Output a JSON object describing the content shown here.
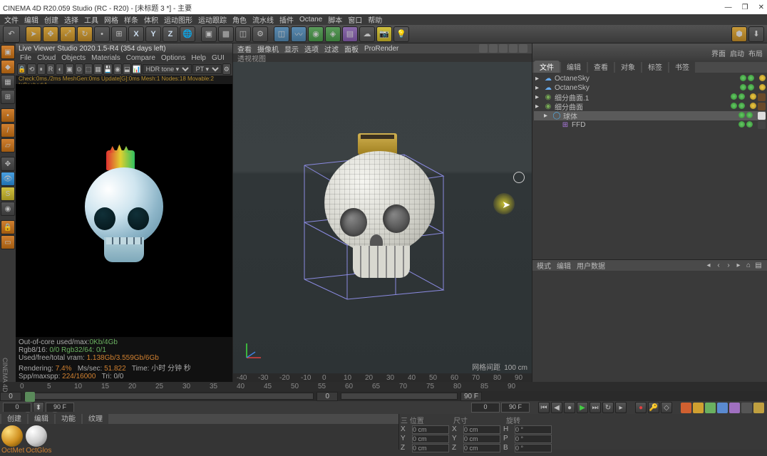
{
  "title": "CINEMA 4D R20.059 Studio (RC - R20) - [未标题 3 *] - 主要",
  "menu": [
    "文件",
    "编辑",
    "创建",
    "选择",
    "工具",
    "网格",
    "样条",
    "体积",
    "运动图形",
    "运动跟踪",
    "角色",
    "流水线",
    "插件",
    "Octane",
    "脚本",
    "窗口",
    "帮助"
  ],
  "right_header": [
    "界面",
    "启动",
    "布局"
  ],
  "live_viewer": {
    "title": "Live Viewer Studio 2020.1.5-R4 (354 days left)",
    "menu": [
      "File",
      "Cloud",
      "Objects",
      "Materials",
      "Compare",
      "Options",
      "Help",
      "GUI"
    ],
    "hdr_mode": "HDR tone ▾",
    "pt": "PT ▾",
    "status": "Check:0ms./2ms  MeshGen:0ms  Update[G]:0ms  Mesh:1 Nodes:18 Movable:2 IsCached:1",
    "stats": {
      "l1": "Out-of-core used/max:",
      "l1v": "0Kb/4Gb",
      "l2": "Rgb8/16:",
      "l2v": "0/0   Rgb32/64: 0/1",
      "l3": "Used/free/total vram:",
      "l3v": "1.138Gb/3.559Gb/6Gb",
      "l4a": "Rendering:",
      "l4av": "7.4%",
      "l4b": "Ms/sec:",
      "l4bv": "51.822",
      "l4c": "Time: 小时  分钟  秒",
      "l4d": "Spp/maxspp:",
      "l4dv": "224/16000",
      "l4e": "Tri: 0/0"
    }
  },
  "viewport": {
    "menu": [
      "查看",
      "摄像机",
      "显示",
      "选项",
      "过滤",
      "面板",
      "ProRender"
    ],
    "title": "透视视图",
    "footer_l": "网格间距",
    "footer_r": "100 cm",
    "ruler": [
      "-40",
      "-30",
      "-20",
      "-10",
      "0",
      "10",
      "20",
      "30",
      "40",
      "50",
      "60",
      "70",
      "80",
      "90"
    ]
  },
  "object_panel": {
    "tabs": [
      "文件",
      "编辑",
      "查看",
      "对象",
      "标签",
      "书签"
    ],
    "tree": [
      {
        "name": "OctaneSky",
        "i": 0,
        "ico": "☁",
        "c": "#6ae"
      },
      {
        "name": "OctaneSky",
        "i": 0,
        "ico": "☁",
        "c": "#6ae"
      },
      {
        "name": "细分曲面.1",
        "i": 0,
        "ico": "◉",
        "c": "#7a5"
      },
      {
        "name": "细分曲面",
        "i": 0,
        "ico": "◉",
        "c": "#7a5"
      },
      {
        "name": "球体",
        "i": 1,
        "ico": "◯",
        "c": "#5ad",
        "sel": true
      },
      {
        "name": "FFD",
        "i": 2,
        "ico": "⊞",
        "c": "#a7d"
      }
    ]
  },
  "attr_tabs": [
    "模式",
    "编辑",
    "用户数据"
  ],
  "timeline": {
    "start": "0",
    "slider_track": true,
    "mid": "0",
    "end": "90 F",
    "ruler": [
      "0",
      "5",
      "10",
      "15",
      "20",
      "25",
      "30",
      "35",
      "40",
      "45",
      "50",
      "55",
      "60",
      "65",
      "70",
      "75",
      "80",
      "85",
      "90"
    ]
  },
  "playback_buttons": [
    "⏮",
    "◀",
    "●",
    "▶",
    "⏭",
    "↻",
    "▸"
  ],
  "mat_tabs": [
    "创建",
    "编辑",
    "功能",
    "纹理"
  ],
  "materials": [
    {
      "name": "OctMet"
    },
    {
      "name": "OctGlos"
    }
  ],
  "coords": {
    "rows": [
      {
        "a": "X",
        "v1": "0 cm",
        "b": "X",
        "v2": "0 cm",
        "c": "H",
        "v3": "0 °"
      },
      {
        "a": "Y",
        "v1": "0 cm",
        "b": "Y",
        "v2": "0 cm",
        "c": "P",
        "v3": "0 °"
      },
      {
        "a": "Z",
        "v1": "0 cm",
        "b": "Z",
        "v2": "0 cm",
        "c": "B",
        "v3": "0 °"
      }
    ]
  },
  "sidebar_label": "CINEMA 4D"
}
